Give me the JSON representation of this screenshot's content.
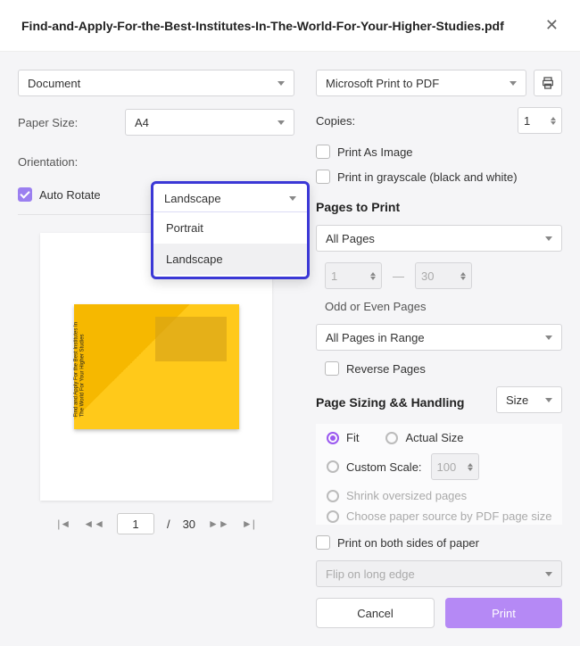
{
  "title": "Find-and-Apply-For-the-Best-Institutes-In-The-World-For-Your-Higher-Studies.pdf",
  "left": {
    "mode": "Document",
    "paper_size_label": "Paper Size:",
    "paper_size_value": "A4",
    "orientation_label": "Orientation:",
    "orientation_value": "Landscape",
    "orientation_options": [
      "Portrait",
      "Landscape"
    ],
    "auto_rotate": "Auto Rotate",
    "preview_caption": "Find and Apply For the Best Institutes In The World For Your Higher Studies",
    "pager": {
      "current": "1",
      "sep": "/",
      "total": "30"
    }
  },
  "right": {
    "printer": "Microsoft Print to PDF",
    "copies_label": "Copies:",
    "copies_value": "1",
    "print_as_image": "Print As Image",
    "grayscale": "Print in grayscale (black and white)",
    "pages_title": "Pages to Print",
    "all_pages": "All Pages",
    "range_from": "1",
    "range_to": "30",
    "odd_even_label": "Odd or Even Pages",
    "odd_even_value": "All Pages in Range",
    "reverse": "Reverse Pages",
    "sizing_title": "Page Sizing && Handling",
    "size_dropdown": "Size",
    "fit": "Fit",
    "actual": "Actual Size",
    "custom_scale": "Custom Scale:",
    "custom_value": "100",
    "shrink": "Shrink oversized pages",
    "choose_source": "Choose paper source by PDF page size",
    "duplex": "Print on both sides of paper",
    "flip": "Flip on long edge",
    "cancel": "Cancel",
    "print": "Print"
  }
}
